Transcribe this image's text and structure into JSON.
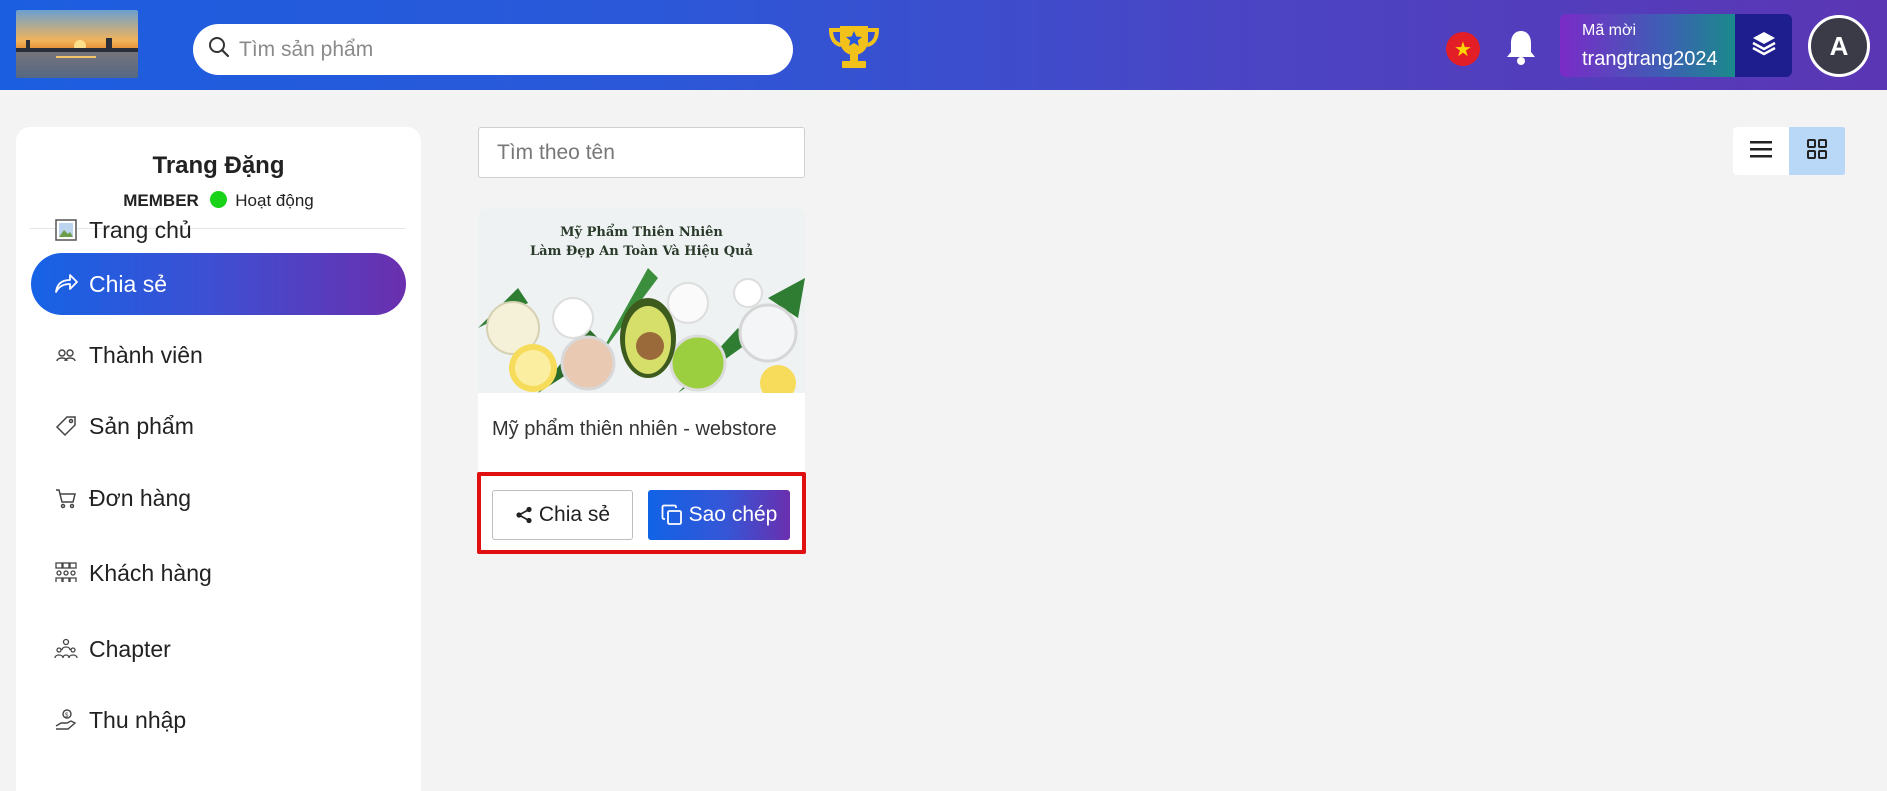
{
  "header": {
    "search_placeholder": "Tìm sản phẩm",
    "invite_label": "Mã mời",
    "invite_code": "trangtrang2024",
    "avatar_initial": "A"
  },
  "profile": {
    "name": "Trang Đặng",
    "role": "MEMBER",
    "status": "Hoạt động",
    "status_color": "#18d318"
  },
  "sidebar": {
    "items": [
      {
        "label": "Trang chủ",
        "icon": "image-icon"
      },
      {
        "label": "Chia sẻ",
        "icon": "share-arrow-icon",
        "active": true
      },
      {
        "label": "Thành viên",
        "icon": "members-icon"
      },
      {
        "label": "Sản phẩm",
        "icon": "tag-icon"
      },
      {
        "label": "Đơn hàng",
        "icon": "cart-icon"
      },
      {
        "label": "Khách hàng",
        "icon": "customers-icon"
      },
      {
        "label": "Chapter",
        "icon": "chapter-icon"
      },
      {
        "label": "Thu nhập",
        "icon": "income-icon"
      }
    ]
  },
  "main": {
    "search_placeholder": "Tìm theo tên",
    "card": {
      "image_line1": "Mỹ Phẩm Thiên Nhiên",
      "image_line2": "Làm Đẹp An Toàn Và Hiệu Quả",
      "title": "Mỹ phẩm thiên nhiên - webstore",
      "share_label": "Chia sẻ",
      "copy_label": "Sao chép"
    }
  },
  "colors": {
    "accent_blue": "#1663e6",
    "accent_purple": "#6a2fae",
    "highlight_red": "#e01010"
  }
}
